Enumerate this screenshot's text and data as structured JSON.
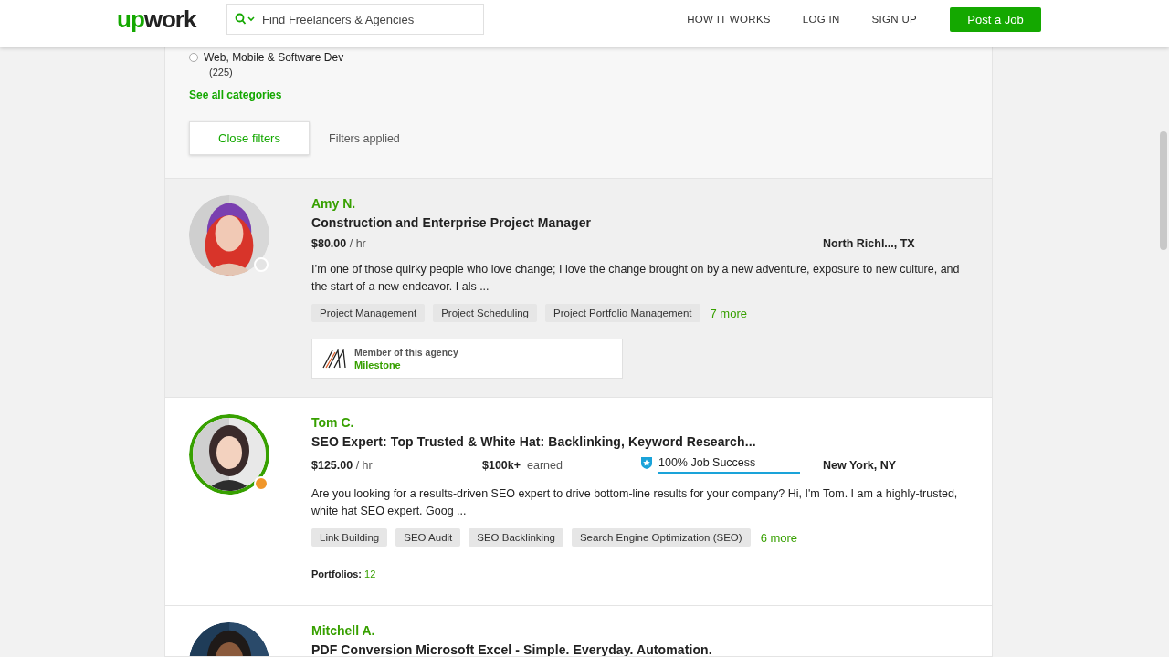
{
  "header": {
    "logo": {
      "accent": "up",
      "rest": "work"
    },
    "search": {
      "placeholder": "Find Freelancers & Agencies"
    },
    "nav": [
      "HOW IT WORKS",
      "LOG IN",
      "SIGN UP"
    ],
    "post_button": "Post a Job"
  },
  "filters": {
    "category": {
      "label": "Web, Mobile & Software Dev",
      "count": "(225)",
      "selected": false
    },
    "see_all": "See all categories",
    "close_button": "Close filters",
    "status": "Filters applied"
  },
  "freelancers": [
    {
      "name": "Amy N.",
      "title": "Construction and Enterprise Project Manager",
      "highlighted": true,
      "ringed": false,
      "color": "#e4e4e4",
      "rate": "$80.00",
      "rate_unit": "/ hr",
      "location": "North Richl..., TX",
      "description": "I’m one of those quirky people who love change; I love the change brought on by a new adventure, exposure to new culture, and the start of a new endeavor. I als ...",
      "skills": [
        "Project Management",
        "Project Scheduling",
        "Project Portfolio Management"
      ],
      "more": "7 more",
      "agency": {
        "label": "Member of this agency",
        "name": "Milestone"
      }
    },
    {
      "name": "Tom C.",
      "title": "SEO Expert: Top Trusted & White Hat: Backlinking, Keyword Research...",
      "highlighted": false,
      "ringed": true,
      "color": "#f0962a",
      "rate": "$125.00",
      "rate_unit": "/ hr",
      "earned": {
        "amount": "$100k+",
        "label": "earned"
      },
      "job_success": {
        "label": "100% Job Success",
        "level": 1
      },
      "location": "New York, NY",
      "description": "Are you looking for a results-driven SEO expert to drive bottom-line results for your company? Hi, I'm Tom. I am a highly-trusted, white hat SEO expert. Goog ...",
      "skills": [
        "Link Building",
        "SEO Audit",
        "SEO Backlinking",
        "Search Engine Optimization (SEO)"
      ],
      "more": "6 more",
      "portfolios": {
        "label": "Portfolios:",
        "count": "12"
      }
    },
    {
      "name": "Mitchell A.",
      "title": "PDF Conversion Microsoft Excel - Simple. Everyday. Automation.",
      "highlighted": false,
      "ringed": false
    }
  ]
}
